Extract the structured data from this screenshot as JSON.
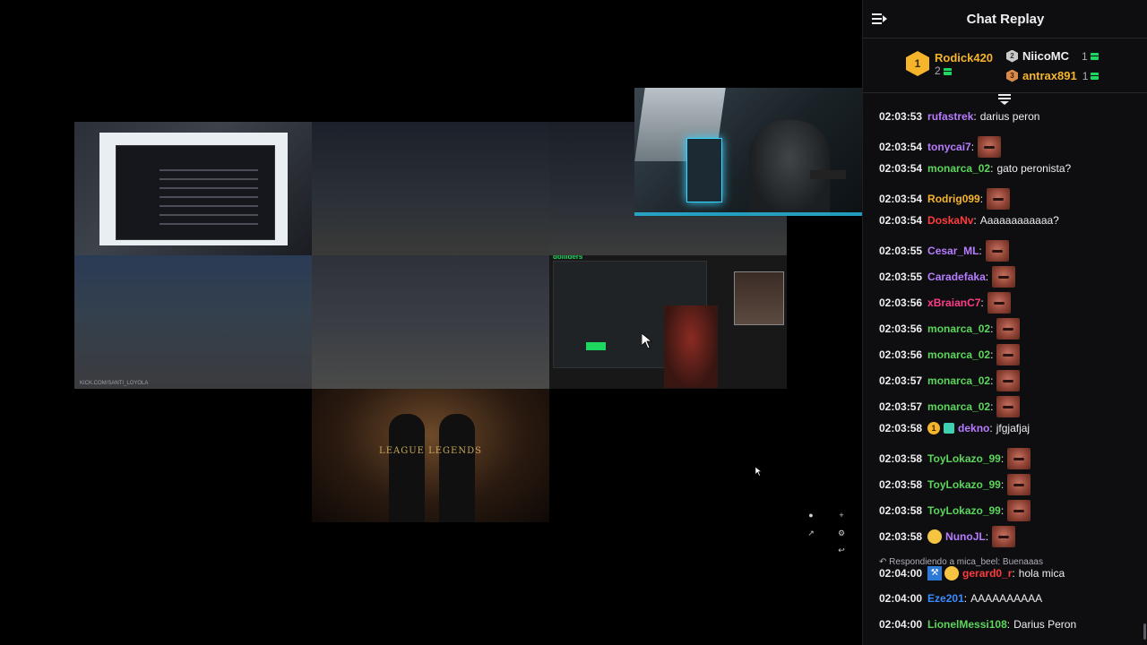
{
  "chat": {
    "title": "Chat Replay",
    "leaderboard": {
      "first": {
        "rank": "1",
        "name": "Rodick420",
        "count": "2",
        "color": "#f5b42a"
      },
      "second": {
        "rank": "2",
        "name": "NiicoMC",
        "count": "1",
        "color": "#efeff1"
      },
      "third": {
        "rank": "3",
        "name": "antrax891",
        "count": "1",
        "color": "#f5b42a"
      }
    },
    "messages": [
      {
        "time": "02:03:53",
        "user": "rufastrek",
        "color": "#b77cff",
        "text": "darius peron",
        "emote": false
      },
      {
        "time": "02:03:54",
        "user": "tonycai7",
        "color": "#b77cff",
        "text": "",
        "emote": true
      },
      {
        "time": "02:03:54",
        "user": "monarca_02",
        "color": "#5bd65b",
        "text": "gato peronista?",
        "emote": false
      },
      {
        "time": "02:03:54",
        "user": "Rodrig099",
        "color": "#f5b42a",
        "text": "",
        "emote": true
      },
      {
        "time": "02:03:54",
        "user": "DoskaNv",
        "color": "#ff3b3b",
        "text": "Aaaaaaaaaaaa?",
        "emote": false
      },
      {
        "time": "02:03:55",
        "user": "Cesar_ML",
        "color": "#b77cff",
        "text": "",
        "emote": true
      },
      {
        "time": "02:03:55",
        "user": "Caradefaka",
        "color": "#b77cff",
        "text": "",
        "emote": true
      },
      {
        "time": "02:03:56",
        "user": "xBraianC7",
        "color": "#ff3b8a",
        "text": "",
        "emote": true
      },
      {
        "time": "02:03:56",
        "user": "monarca_02",
        "color": "#5bd65b",
        "text": "",
        "emote": true
      },
      {
        "time": "02:03:56",
        "user": "monarca_02",
        "color": "#5bd65b",
        "text": "",
        "emote": true
      },
      {
        "time": "02:03:57",
        "user": "monarca_02",
        "color": "#5bd65b",
        "text": "",
        "emote": true
      },
      {
        "time": "02:03:57",
        "user": "monarca_02",
        "color": "#5bd65b",
        "text": "",
        "emote": true
      },
      {
        "time": "02:03:58",
        "user": "dekno",
        "color": "#b77cff",
        "text": "jfgjafjaj",
        "emote": false,
        "badges": "sub"
      },
      {
        "time": "02:03:58",
        "user": "ToyLokazo_99",
        "color": "#5bd65b",
        "text": "",
        "emote": true
      },
      {
        "time": "02:03:58",
        "user": "ToyLokazo_99",
        "color": "#5bd65b",
        "text": "",
        "emote": true
      },
      {
        "time": "02:03:58",
        "user": "ToyLokazo_99",
        "color": "#5bd65b",
        "text": "",
        "emote": true
      },
      {
        "time": "02:03:58",
        "user": "NunoJL",
        "color": "#b77cff",
        "text": "",
        "emote": true,
        "badges": "face"
      },
      {
        "time": "02:04:00",
        "user": "gerard0_r",
        "color": "#ff3b3b",
        "text": "hola mica",
        "emote": false,
        "badges": "blue",
        "reply": "Respondiendo a mica_beel: Buenaaas"
      },
      {
        "time": "02:04:00",
        "user": "Eze201",
        "color": "#3b8bff",
        "text": "AAAAAAAAAA",
        "emote": false
      },
      {
        "time": "02:04:00",
        "user": "LionelMessi108",
        "color": "#5bd65b",
        "text": "Darius Peron",
        "emote": false
      }
    ]
  },
  "stream": {
    "tile6_title": "dolliders",
    "tile7_logo": "LEAGUE LEGENDS",
    "tile4_caption": "KICK.COM/SANTI_LOYOLA"
  }
}
